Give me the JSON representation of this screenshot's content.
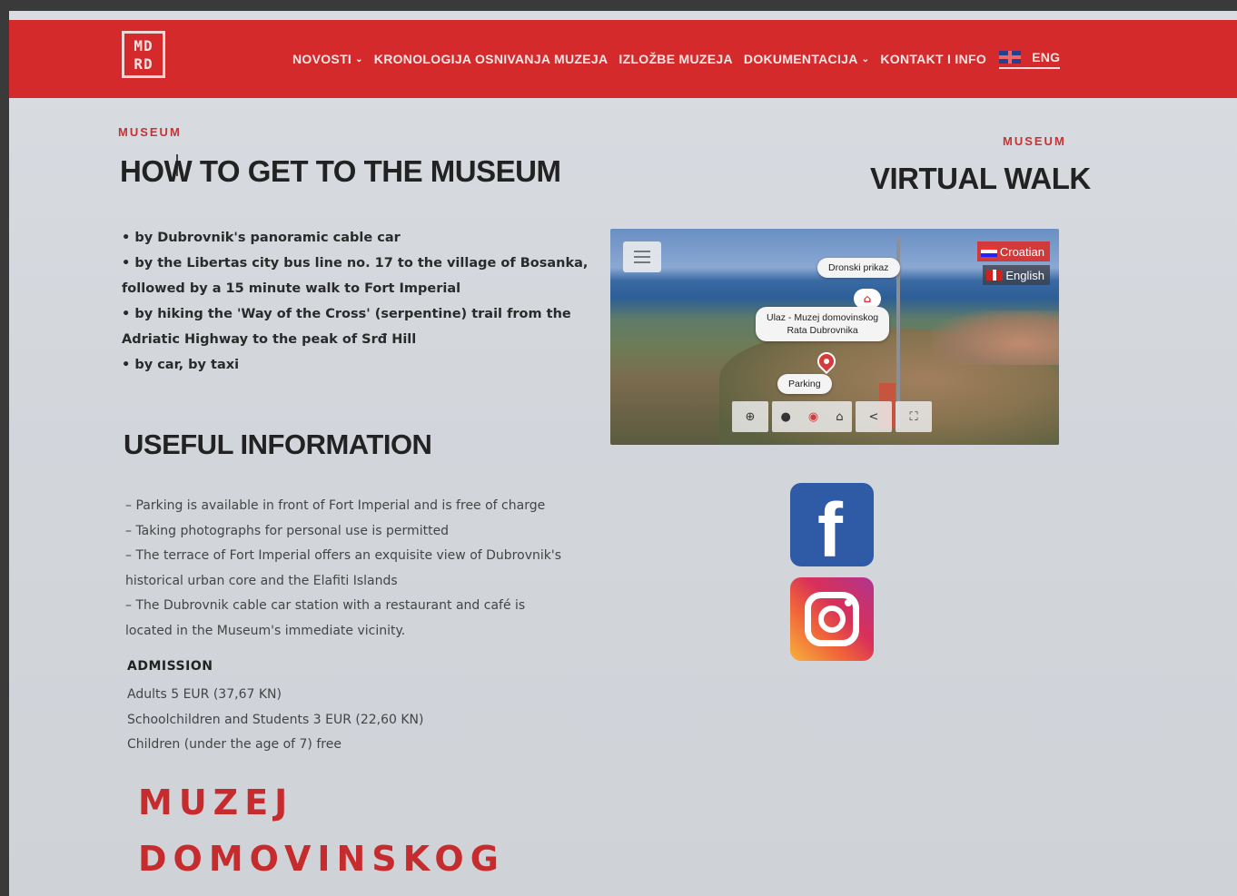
{
  "logo": {
    "line1": "MD",
    "line2": "RD"
  },
  "nav": {
    "items": [
      {
        "label": "NOVOSTI",
        "has_dropdown": true
      },
      {
        "label": "KRONOLOGIJA OSNIVANJA MUZEJA",
        "has_dropdown": false
      },
      {
        "label": "IZLOŽBE MUZEJA",
        "has_dropdown": false
      },
      {
        "label": "DOKUMENTACIJA",
        "has_dropdown": true
      },
      {
        "label": "KONTAKT I INFO",
        "has_dropdown": false
      }
    ],
    "language": "ENG",
    "language_icon": "uk-flag-icon"
  },
  "how_to": {
    "eyebrow": "MUSEUM",
    "title": "HOW TO GET TO THE MUSEUM",
    "lines": [
      "• by Dubrovnik's panoramic cable car",
      "• by the Libertas city bus line no. 17 to the village of Bosanka,",
      "followed by a 15 minute walk to Fort Imperial",
      "• by hiking the 'Way of the Cross' (serpentine) trail from the",
      "Adriatic Highway to the peak of Srđ Hill",
      "• by car, by taxi"
    ]
  },
  "useful": {
    "title": "USEFUL INFORMATION",
    "lines": [
      "– Parking is available in front of Fort Imperial and is free of charge",
      "– Taking photographs for personal use is permitted",
      "– The terrace of Fort Imperial offers an exquisite view of Dubrovnik's",
      "historical urban core and the Elafiti Islands",
      "– The Dubrovnik cable car station with a restaurant and café is",
      "located in the Museum's immediate vicinity."
    ]
  },
  "admission": {
    "title": "ADMISSION",
    "lines": [
      "Adults 5 EUR (37,67 KN)",
      "Schoolchildren and Students 3 EUR (22,60 KN)",
      "Children (under the age of 7) free"
    ]
  },
  "brand_text": {
    "line1": "MUZEJ",
    "line2": "DOMOVINSKOG"
  },
  "virtual_walk": {
    "eyebrow": "MUSEUM",
    "title": "VIRTUAL WALK",
    "lang_croatian": "Croatian",
    "lang_english": "English",
    "hotspot_drone": "Dronski prikaz",
    "hotspot_entrance_1": "Ulaz - Muzej domovinskog",
    "hotspot_entrance_2": "Rata Dubrovnika",
    "hotspot_parking": "Parking"
  },
  "social": {
    "facebook_icon": "facebook-icon",
    "instagram_icon": "instagram-icon"
  },
  "colors": {
    "brand_red": "#d42a2c",
    "facebook": "#2f5aa5"
  }
}
